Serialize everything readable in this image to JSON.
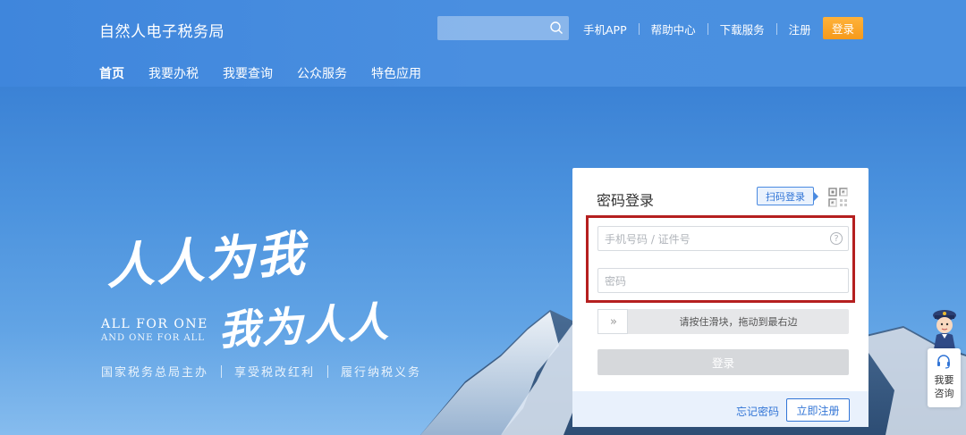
{
  "header": {
    "site_title": "自然人电子税务局",
    "search": {
      "placeholder": ""
    },
    "top_links": [
      "手机APP",
      "帮助中心",
      "下载服务",
      "注册"
    ],
    "login_label": "登录"
  },
  "nav": {
    "items": [
      {
        "label": "首页",
        "active": true
      },
      {
        "label": "我要办税",
        "active": false
      },
      {
        "label": "我要查询",
        "active": false
      },
      {
        "label": "公众服务",
        "active": false
      },
      {
        "label": "特色应用",
        "active": false
      }
    ]
  },
  "hero": {
    "calligraphy_line1": "人人为我",
    "calligraphy_line2": "我为人人",
    "english_line1": "ALL FOR ONE",
    "english_line2": "AND ONE FOR ALL",
    "slogans": [
      "国家税务总局主办",
      "享受税改红利",
      "履行纳税义务"
    ]
  },
  "login": {
    "title": "密码登录",
    "qr_tag": "扫码登录",
    "phone_placeholder": "手机号码 / 证件号",
    "password_placeholder": "密码",
    "help_symbol": "?",
    "slider_handle": "»",
    "slider_text": "请按住滑块，拖动到最右边",
    "submit_label": "登录",
    "forgot_label": "忘记密码",
    "register_label": "立即注册"
  },
  "consult": {
    "label": "我要\n咨询"
  },
  "colors": {
    "header_blue": "#4a8fe0",
    "login_orange": "#f59a1b",
    "link_blue": "#3275d6",
    "highlight_red": "#b51f1f"
  }
}
